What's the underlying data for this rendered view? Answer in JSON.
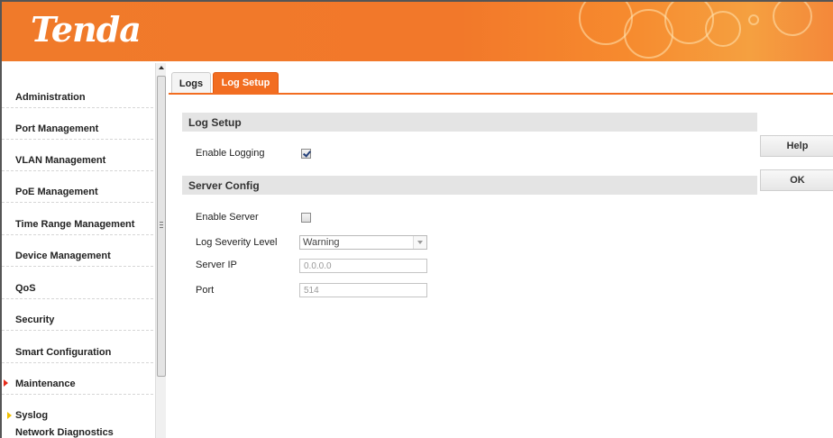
{
  "header": {
    "logo": "Tenda"
  },
  "sidebar": {
    "items": [
      {
        "label": "Administration"
      },
      {
        "label": "Port Management"
      },
      {
        "label": "VLAN Management"
      },
      {
        "label": "PoE Management"
      },
      {
        "label": "Time Range Management"
      },
      {
        "label": "Device Management"
      },
      {
        "label": "QoS"
      },
      {
        "label": "Security"
      },
      {
        "label": "Smart Configuration"
      },
      {
        "label": "Maintenance",
        "active": true
      }
    ],
    "subitems": [
      {
        "label": "Syslog",
        "active": true
      },
      {
        "label": "Network Diagnostics"
      }
    ]
  },
  "tabs": [
    {
      "label": "Logs"
    },
    {
      "label": "Log Setup",
      "active": true
    }
  ],
  "log_setup": {
    "title": "Log Setup",
    "enable_logging_label": "Enable Logging",
    "enable_logging": true
  },
  "server_config": {
    "title": "Server Config",
    "enable_server_label": "Enable Server",
    "enable_server": false,
    "severity_label": "Log Severity Level",
    "severity_value": "Warning",
    "server_ip_label": "Server IP",
    "server_ip_value": "0.0.0.0",
    "port_label": "Port",
    "port_value": "514"
  },
  "buttons": {
    "help": "Help",
    "ok": "OK"
  },
  "colors": {
    "accent": "#f26d21",
    "section_bg": "#e4e4e4"
  }
}
